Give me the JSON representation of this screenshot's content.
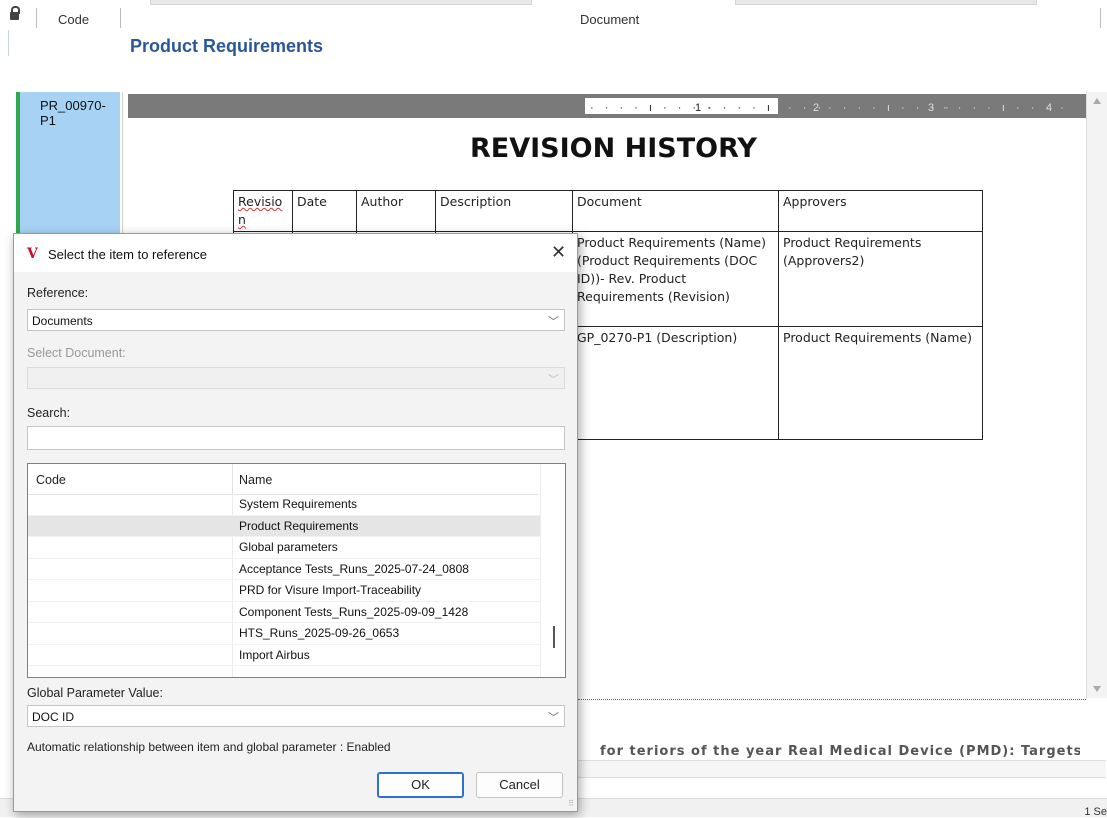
{
  "header": {
    "code_col": "Code",
    "document_col": "Document"
  },
  "group_title": "Product Requirements",
  "row": {
    "code": "PR_00970-P1"
  },
  "ruler": {
    "marks": [
      "1",
      "2",
      "3",
      "4"
    ]
  },
  "document": {
    "heading": "REVISION HISTORY",
    "table": {
      "headers": [
        "Revisio n",
        "Date",
        "Author",
        "Description",
        "Document",
        "Approvers"
      ],
      "row1": {
        "document": "Product Requirements (Name) (Product Requirements (DOC ID))- Rev. Product Requirements (Revision)",
        "approvers": "Product Requirements (Approvers2)"
      },
      "row2": {
        "document": "GP_0270-P1 (Description)",
        "approvers": "Product Requirements (Name)"
      }
    },
    "footer_fragment": "for teriors of the year Real Medical Device (PMD): Targets"
  },
  "statusbar": {
    "right_text": "1 Se"
  },
  "dialog": {
    "logo": "V",
    "title": "Select the item to reference",
    "reference_label": "Reference:",
    "reference_value": "Documents",
    "select_document_label": "Select Document:",
    "select_document_value": "",
    "search_label": "Search:",
    "search_value": "",
    "list": {
      "headers": {
        "code": "Code",
        "name": "Name"
      },
      "rows": [
        {
          "code": "",
          "name": "System Requirements",
          "selected": false
        },
        {
          "code": "",
          "name": "Product Requirements",
          "selected": true
        },
        {
          "code": "",
          "name": "Global parameters",
          "selected": false
        },
        {
          "code": "",
          "name": "Acceptance Tests_Runs_2025-07-24_0808",
          "selected": false
        },
        {
          "code": "",
          "name": "PRD for Visure Import-Traceability",
          "selected": false
        },
        {
          "code": "",
          "name": "Component Tests_Runs_2025-09-09_1428",
          "selected": false
        },
        {
          "code": "",
          "name": "HTS_Runs_2025-09-26_0653",
          "selected": false
        },
        {
          "code": "",
          "name": "Import Airbus",
          "selected": false
        }
      ]
    },
    "global_param_label": "Global Parameter Value:",
    "global_param_value": "DOC ID",
    "auto_rel_text": "Automatic relationship between item and global parameter : Enabled",
    "ok_label": "OK",
    "cancel_label": "Cancel"
  }
}
